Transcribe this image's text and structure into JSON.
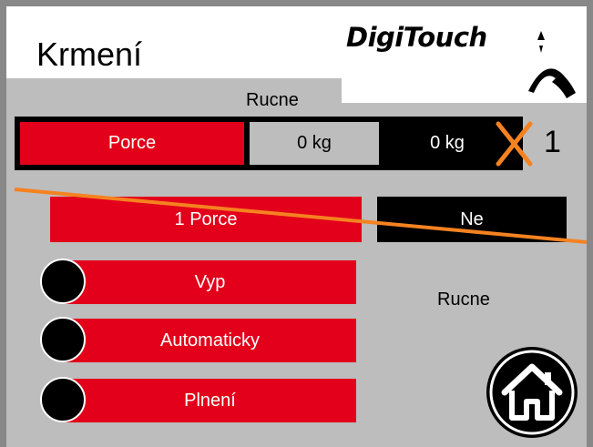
{
  "header": {
    "title": "Krmení",
    "brand": "DigiTouch"
  },
  "mode_label_top": "Rucne",
  "portion_row": {
    "label": "Porce",
    "value_1": "0 kg",
    "value_2": "0 kg",
    "index": "1"
  },
  "portion_button": "1 Porce",
  "ne_button": "Ne",
  "mode_buttons": [
    {
      "label": "Vyp"
    },
    {
      "label": "Automaticky"
    },
    {
      "label": "Plnení"
    }
  ],
  "mode_label_right": "Rucne",
  "colors": {
    "accent_red": "#e2001a",
    "panel_grey": "#bdbdbd",
    "strike_orange": "#f58220",
    "frame_grey": "#888888"
  }
}
